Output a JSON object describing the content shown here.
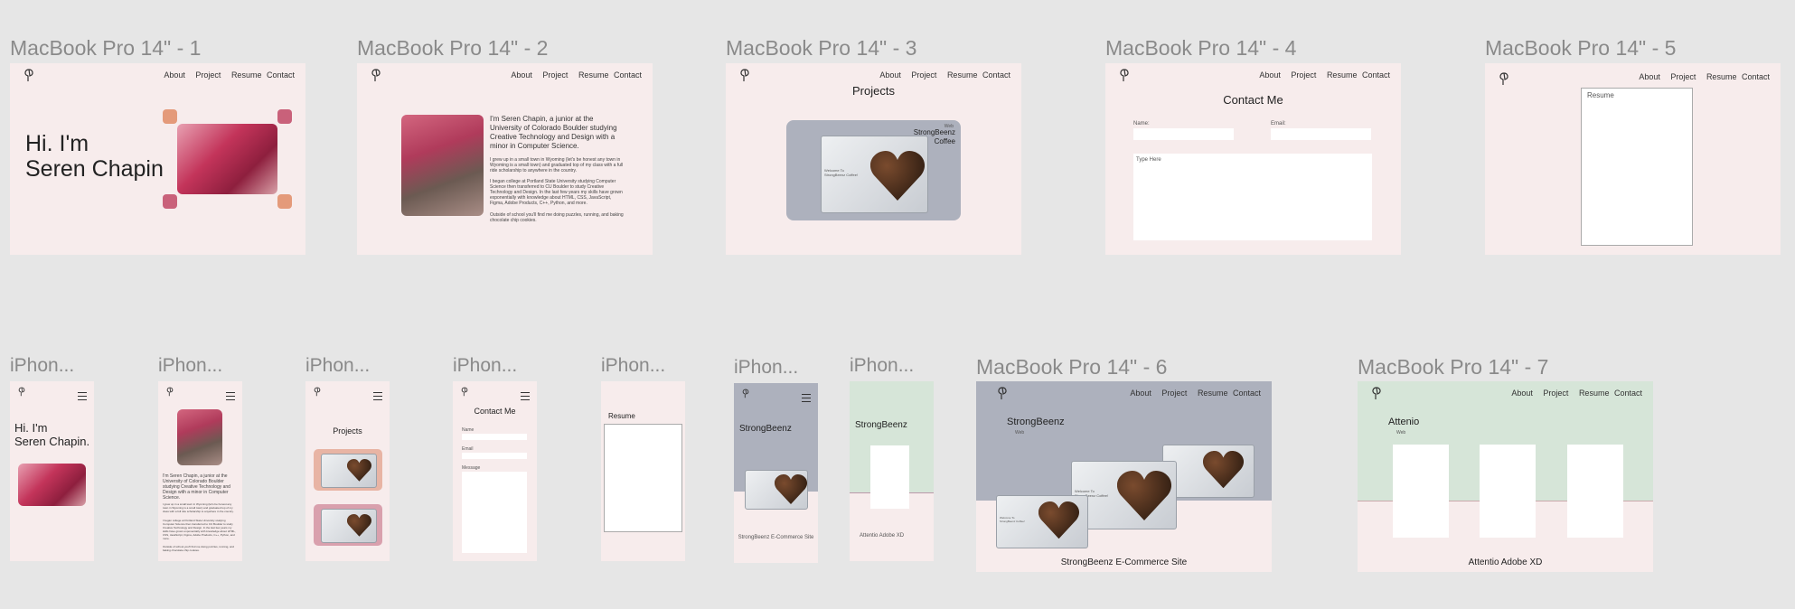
{
  "frames": {
    "mac1": "MacBook Pro 14\" - 1",
    "mac2": "MacBook Pro 14\" - 2",
    "mac3": "MacBook Pro 14\" - 3",
    "mac4": "MacBook Pro 14\" - 4",
    "mac5": "MacBook Pro 14\" - 5",
    "mac6": "MacBook Pro 14\" - 6",
    "mac7": "MacBook Pro 14\" - 7",
    "iphone": "iPhon..."
  },
  "nav": {
    "about": "About",
    "project": "Project",
    "resume": "Resume",
    "contact": "Contact"
  },
  "hero": {
    "line1": "Hi. I'm",
    "line2": "Seren Chapin",
    "line2_mobile": "Seren Chapin."
  },
  "about": {
    "intro": "I'm Seren Chapin, a junior at the University of Colorado Boulder studying Creative Technology and Design with a minor in Computer Science.",
    "p1": "I grew up in a small town in Wyoming (let's be honest any town in Wyoming is a small town) and graduated top of my class with a full ride scholarship to anywhere in the country.",
    "p2": "I began college at Portland State University studying Computer Science then transferred to CU Boulder to study Creative Technology and Design. In the last few years my skills have grown exponentially with knowledge about HTML, CSS, JavaScript, Figma, Adobe Products, C++, Python, and more.",
    "p3": "Outside of school you'll find me doing puzzles, running, and baking chocolate chip cookies."
  },
  "projects": {
    "title": "Projects",
    "card_title_1": "StrongBeenz",
    "card_title_2": "Coffee",
    "card_nav": "Web",
    "welcome": "Welcome To StrongBeenz Coffee!"
  },
  "contact": {
    "title": "Contact Me",
    "name": "Name:",
    "email": "Email:",
    "message": "Type Here",
    "name_m": "Name",
    "email_m": "Email",
    "message_m": "Message"
  },
  "resume": {
    "title": "Resume"
  },
  "strongbeenz": {
    "title": "StrongBeenz",
    "sub": "Web",
    "caption": "StrongBeenz E-Commerce Site"
  },
  "attenio": {
    "title": "Attenio",
    "sub": "Web",
    "caption": "Attentio Adobe XD",
    "caption_m": "Attentio Adobe XD",
    "title_m": "StrongBeenz"
  },
  "colors": {
    "canvas": "#e6e6e6",
    "frame": "#f7ecec",
    "slate": "#adb1bd",
    "sage": "#d6e5d8",
    "accent_orange": "#e49a7a",
    "accent_rose": "#c9617a"
  }
}
